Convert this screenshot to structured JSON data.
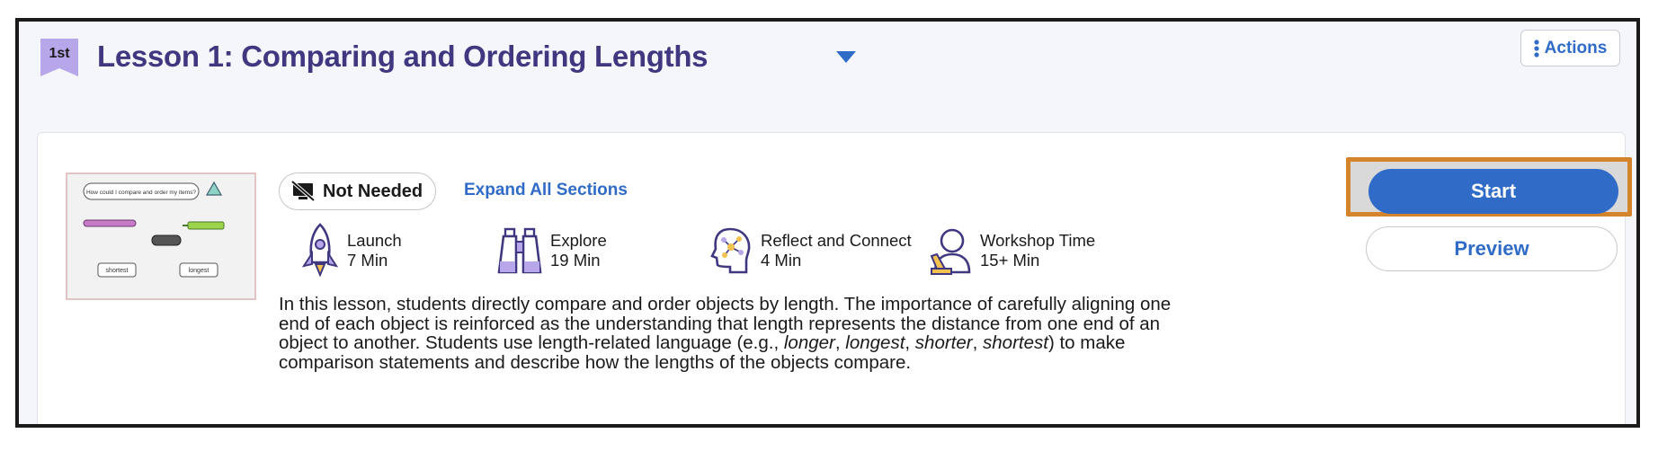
{
  "lesson": {
    "grade_badge": "1st",
    "title": "Lesson 1: Comparing and Ordering Lengths",
    "actions_label": "Actions"
  },
  "card": {
    "thumbnail": {
      "question": "How could I compare and order my items?",
      "labels": [
        "shortest",
        "longest"
      ]
    },
    "badge_label": "Not Needed",
    "expand_label": "Expand All Sections",
    "phases": [
      {
        "name": "Launch",
        "duration": "7 Min",
        "icon": "rocket-icon"
      },
      {
        "name": "Explore",
        "duration": "19 Min",
        "icon": "binoculars-icon"
      },
      {
        "name": "Reflect and Connect",
        "duration": "4 Min",
        "icon": "head-network-icon"
      },
      {
        "name": "Workshop Time",
        "duration": "15+ Min",
        "icon": "person-icon"
      }
    ],
    "description_before": "In this lesson, students directly compare and order objects by length. The importance of carefully aligning one end of each object is reinforced as the understanding that length represents the distance from one end of an object to another. Students use length-related language (e.g., ",
    "description_terms": [
      "longer",
      "longest",
      "shorter",
      "shortest"
    ],
    "description_after": ") to make comparison statements and describe how the lengths of the objects compare.",
    "start_label": "Start",
    "preview_label": "Preview"
  },
  "colors": {
    "title": "#3f3880",
    "accent": "#2f6bc7",
    "highlight": "#d4852b",
    "grade_flag": "#b8a6ea"
  }
}
